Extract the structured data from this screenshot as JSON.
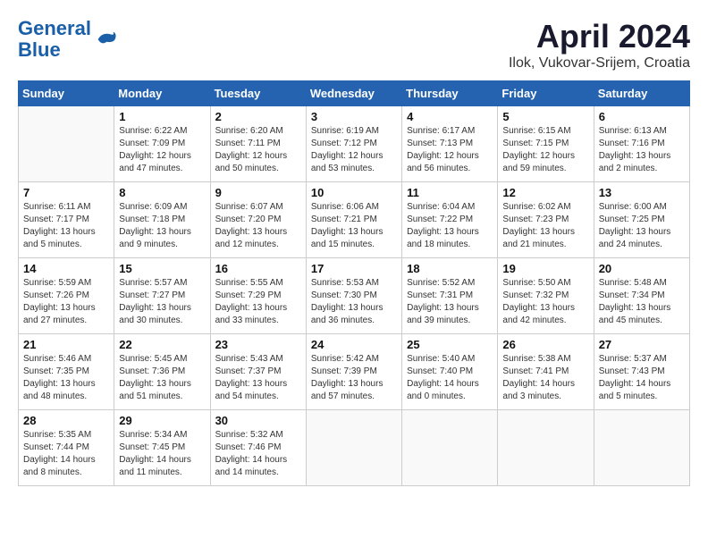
{
  "header": {
    "logo_line1": "General",
    "logo_line2": "Blue",
    "title": "April 2024",
    "subtitle": "Ilok, Vukovar-Srijem, Croatia"
  },
  "weekdays": [
    "Sunday",
    "Monday",
    "Tuesday",
    "Wednesday",
    "Thursday",
    "Friday",
    "Saturday"
  ],
  "weeks": [
    [
      {
        "day": "",
        "info": ""
      },
      {
        "day": "1",
        "info": "Sunrise: 6:22 AM\nSunset: 7:09 PM\nDaylight: 12 hours\nand 47 minutes."
      },
      {
        "day": "2",
        "info": "Sunrise: 6:20 AM\nSunset: 7:11 PM\nDaylight: 12 hours\nand 50 minutes."
      },
      {
        "day": "3",
        "info": "Sunrise: 6:19 AM\nSunset: 7:12 PM\nDaylight: 12 hours\nand 53 minutes."
      },
      {
        "day": "4",
        "info": "Sunrise: 6:17 AM\nSunset: 7:13 PM\nDaylight: 12 hours\nand 56 minutes."
      },
      {
        "day": "5",
        "info": "Sunrise: 6:15 AM\nSunset: 7:15 PM\nDaylight: 12 hours\nand 59 minutes."
      },
      {
        "day": "6",
        "info": "Sunrise: 6:13 AM\nSunset: 7:16 PM\nDaylight: 13 hours\nand 2 minutes."
      }
    ],
    [
      {
        "day": "7",
        "info": "Sunrise: 6:11 AM\nSunset: 7:17 PM\nDaylight: 13 hours\nand 5 minutes."
      },
      {
        "day": "8",
        "info": "Sunrise: 6:09 AM\nSunset: 7:18 PM\nDaylight: 13 hours\nand 9 minutes."
      },
      {
        "day": "9",
        "info": "Sunrise: 6:07 AM\nSunset: 7:20 PM\nDaylight: 13 hours\nand 12 minutes."
      },
      {
        "day": "10",
        "info": "Sunrise: 6:06 AM\nSunset: 7:21 PM\nDaylight: 13 hours\nand 15 minutes."
      },
      {
        "day": "11",
        "info": "Sunrise: 6:04 AM\nSunset: 7:22 PM\nDaylight: 13 hours\nand 18 minutes."
      },
      {
        "day": "12",
        "info": "Sunrise: 6:02 AM\nSunset: 7:23 PM\nDaylight: 13 hours\nand 21 minutes."
      },
      {
        "day": "13",
        "info": "Sunrise: 6:00 AM\nSunset: 7:25 PM\nDaylight: 13 hours\nand 24 minutes."
      }
    ],
    [
      {
        "day": "14",
        "info": "Sunrise: 5:59 AM\nSunset: 7:26 PM\nDaylight: 13 hours\nand 27 minutes."
      },
      {
        "day": "15",
        "info": "Sunrise: 5:57 AM\nSunset: 7:27 PM\nDaylight: 13 hours\nand 30 minutes."
      },
      {
        "day": "16",
        "info": "Sunrise: 5:55 AM\nSunset: 7:29 PM\nDaylight: 13 hours\nand 33 minutes."
      },
      {
        "day": "17",
        "info": "Sunrise: 5:53 AM\nSunset: 7:30 PM\nDaylight: 13 hours\nand 36 minutes."
      },
      {
        "day": "18",
        "info": "Sunrise: 5:52 AM\nSunset: 7:31 PM\nDaylight: 13 hours\nand 39 minutes."
      },
      {
        "day": "19",
        "info": "Sunrise: 5:50 AM\nSunset: 7:32 PM\nDaylight: 13 hours\nand 42 minutes."
      },
      {
        "day": "20",
        "info": "Sunrise: 5:48 AM\nSunset: 7:34 PM\nDaylight: 13 hours\nand 45 minutes."
      }
    ],
    [
      {
        "day": "21",
        "info": "Sunrise: 5:46 AM\nSunset: 7:35 PM\nDaylight: 13 hours\nand 48 minutes."
      },
      {
        "day": "22",
        "info": "Sunrise: 5:45 AM\nSunset: 7:36 PM\nDaylight: 13 hours\nand 51 minutes."
      },
      {
        "day": "23",
        "info": "Sunrise: 5:43 AM\nSunset: 7:37 PM\nDaylight: 13 hours\nand 54 minutes."
      },
      {
        "day": "24",
        "info": "Sunrise: 5:42 AM\nSunset: 7:39 PM\nDaylight: 13 hours\nand 57 minutes."
      },
      {
        "day": "25",
        "info": "Sunrise: 5:40 AM\nSunset: 7:40 PM\nDaylight: 14 hours\nand 0 minutes."
      },
      {
        "day": "26",
        "info": "Sunrise: 5:38 AM\nSunset: 7:41 PM\nDaylight: 14 hours\nand 3 minutes."
      },
      {
        "day": "27",
        "info": "Sunrise: 5:37 AM\nSunset: 7:43 PM\nDaylight: 14 hours\nand 5 minutes."
      }
    ],
    [
      {
        "day": "28",
        "info": "Sunrise: 5:35 AM\nSunset: 7:44 PM\nDaylight: 14 hours\nand 8 minutes."
      },
      {
        "day": "29",
        "info": "Sunrise: 5:34 AM\nSunset: 7:45 PM\nDaylight: 14 hours\nand 11 minutes."
      },
      {
        "day": "30",
        "info": "Sunrise: 5:32 AM\nSunset: 7:46 PM\nDaylight: 14 hours\nand 14 minutes."
      },
      {
        "day": "",
        "info": ""
      },
      {
        "day": "",
        "info": ""
      },
      {
        "day": "",
        "info": ""
      },
      {
        "day": "",
        "info": ""
      }
    ]
  ]
}
